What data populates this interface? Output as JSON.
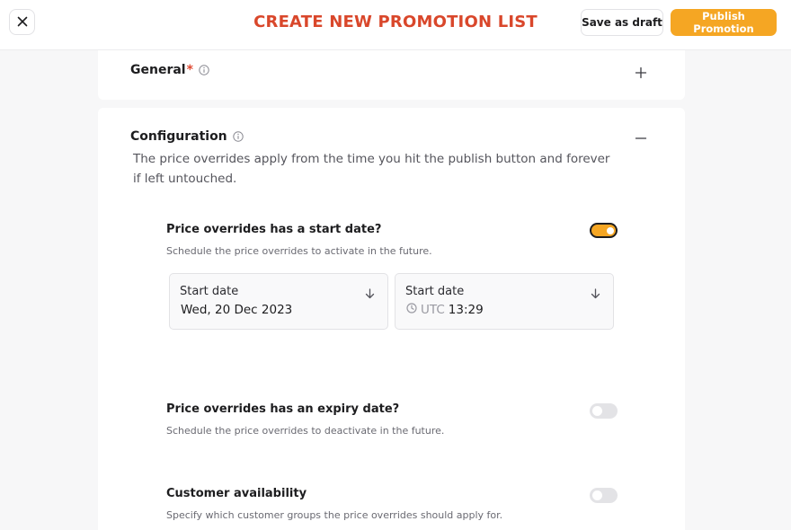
{
  "header": {
    "title": "CREATE NEW PROMOTION LIST",
    "save_draft_label": "Save as draft",
    "publish_label": "Publish Promotion",
    "accent_color": "#f5a623",
    "title_color": "#d9472b"
  },
  "general": {
    "title": "General",
    "required_mark": "*"
  },
  "configuration": {
    "title": "Configuration",
    "description": "The price overrides apply from the time you hit the publish button and forever if left untouched.",
    "start_date": {
      "title": "Price overrides has a start date?",
      "subtitle": "Schedule the price overrides to activate in the future.",
      "enabled": true,
      "date_field": {
        "label": "Start date",
        "value": "Wed, 20 Dec 2023"
      },
      "time_field": {
        "label": "Start date",
        "timezone": "UTC",
        "value": "13:29"
      }
    },
    "expiry_date": {
      "title": "Price overrides has an expiry date?",
      "subtitle": "Schedule the price overrides to deactivate in the future.",
      "enabled": false
    },
    "customer_availability": {
      "title": "Customer availability",
      "subtitle": "Specify which customer groups the price overrides should apply for.",
      "enabled": false
    }
  }
}
